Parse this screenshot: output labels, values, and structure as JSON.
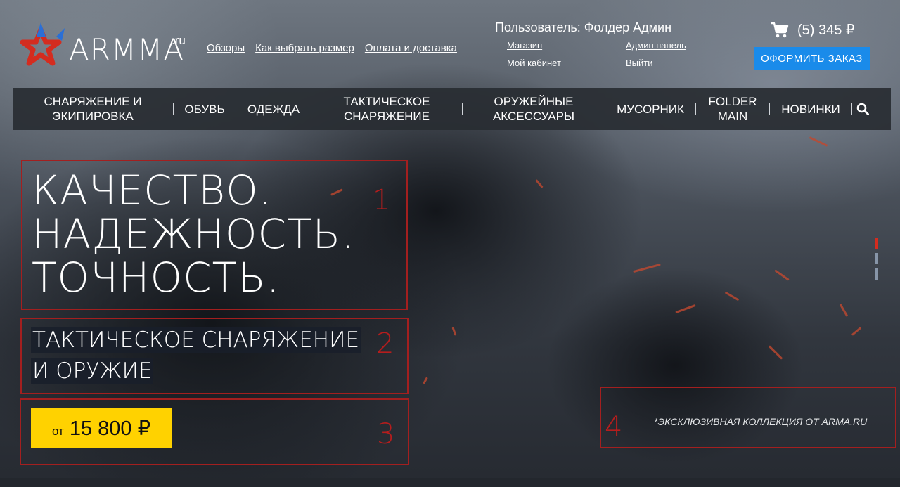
{
  "brand": {
    "name": "ARMMA",
    "tld": ".ru"
  },
  "header": {
    "top_links": [
      "Обзоры",
      "Как выбрать размер",
      "Оплата и доставка"
    ],
    "user": "Пользователь: Фолдер Админ",
    "user_links": [
      "Магазин",
      "Админ панель",
      "Мой кабинет",
      "Выйти"
    ],
    "cart_summary": "(5) 345 ₽",
    "order_button": "ОФОРМИТЬ ЗАКАЗ"
  },
  "nav": {
    "items": [
      "СНАРЯЖЕНИЕ И ЭКИПИРОВКА",
      "ОБУВЬ",
      "ОДЕЖДА",
      "ТАКТИЧЕСКОЕ СНАРЯЖЕНИЕ",
      "ОРУЖЕЙНЫЕ АКСЕССУАРЫ",
      "МУСОРНИК",
      "FOLDER MAIN",
      "НОВИНКИ"
    ]
  },
  "hero": {
    "headline": [
      "КАЧЕСТВО.",
      "НАДЕЖНОСТЬ.",
      "ТОЧНОСТЬ."
    ],
    "subhead": [
      "ТАКТИЧЕСКОЕ СНАРЯЖЕНИЕ",
      "И ОРУЖИЕ"
    ],
    "price_prefix": "от",
    "price": "15 800 ₽",
    "exclusive_note": "*ЭКСКЛЮЗИВНАЯ КОЛЛЕКЦИЯ ОТ ARMA.RU",
    "box_numbers": [
      "1",
      "2",
      "3",
      "4"
    ],
    "slides_total": 3,
    "slide_active": 1
  },
  "colors": {
    "accent_blue": "#1a8bea",
    "price_yellow": "#ffd200",
    "annotation_red": "#a31f1f",
    "nav_bg": "#282c32"
  },
  "icons": [
    "logo-star-icon",
    "cart-icon",
    "search-icon"
  ]
}
